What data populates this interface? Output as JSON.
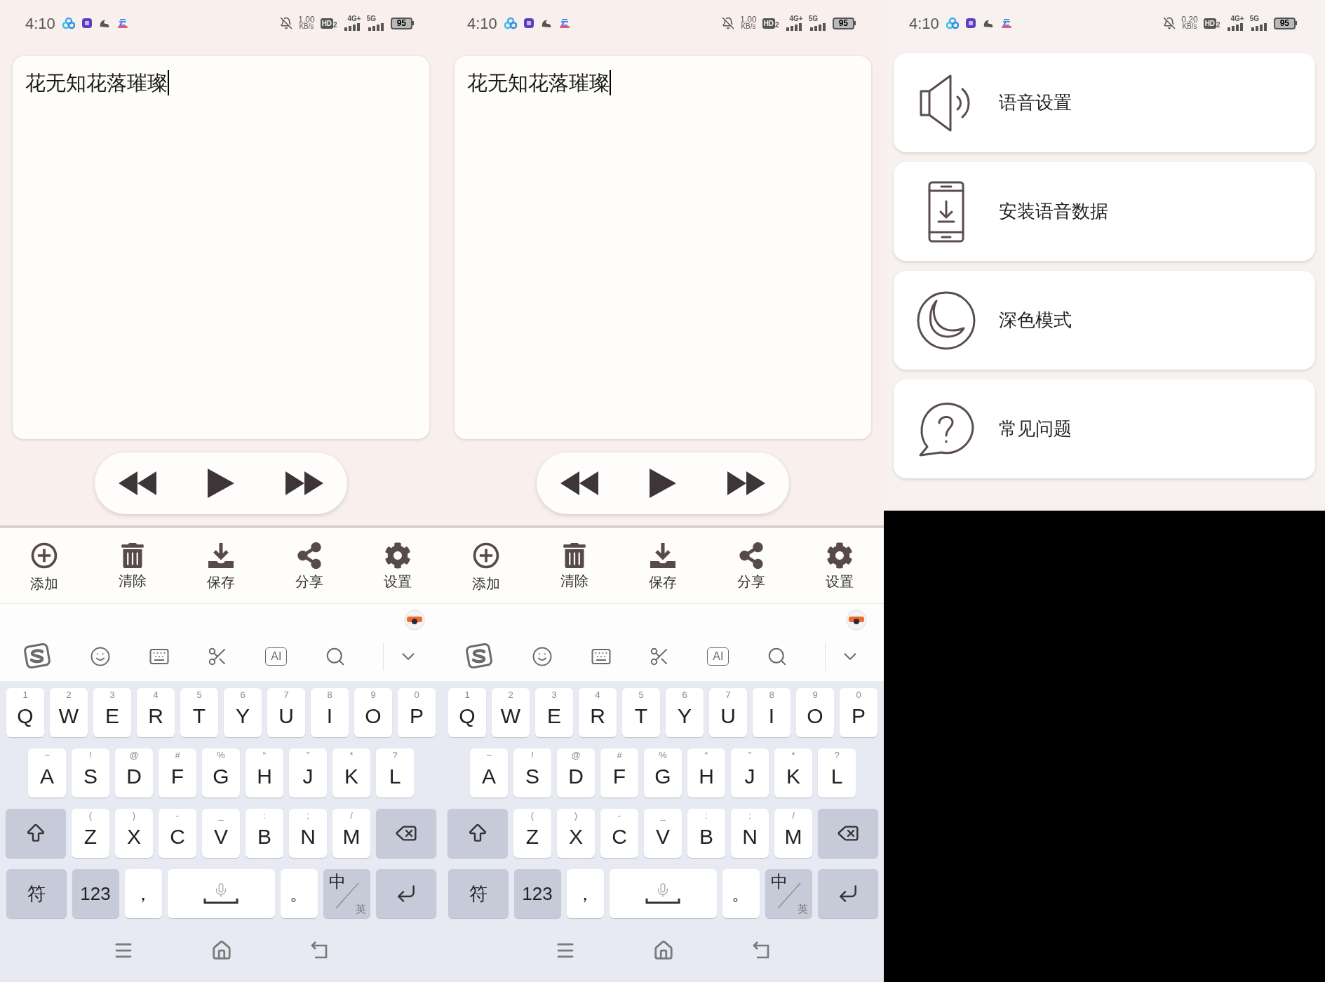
{
  "screens": [
    {
      "kind": "editor",
      "status_bar": {
        "time": "4:10",
        "speed": "1.00",
        "speed_unit": "KB/s",
        "hd": "HD",
        "hd_sub": "2",
        "network_1": "4G+",
        "network_2": "5G",
        "battery": "95"
      },
      "text": "花无知花落璀璨",
      "player": [
        {
          "kind": "rewind"
        },
        {
          "kind": "play"
        },
        {
          "kind": "forward"
        }
      ],
      "toolbar": [
        {
          "kind": "add",
          "label": "添加"
        },
        {
          "kind": "clear",
          "label": "清除"
        },
        {
          "kind": "save",
          "label": "保存"
        },
        {
          "kind": "share",
          "label": "分享"
        },
        {
          "kind": "settings",
          "label": "设置"
        }
      ],
      "keyboard_tools": [
        {
          "kind": "logo"
        },
        {
          "kind": "emoji"
        },
        {
          "kind": "keyboard"
        },
        {
          "kind": "cut"
        },
        {
          "kind": "ai",
          "label": "AI"
        },
        {
          "kind": "search"
        },
        {
          "kind": "collapse"
        }
      ],
      "keyboard_rows": [
        [
          {
            "kind": "letter",
            "label": "Q",
            "hint": "1"
          },
          {
            "kind": "letter",
            "label": "W",
            "hint": "2"
          },
          {
            "kind": "letter",
            "label": "E",
            "hint": "3"
          },
          {
            "kind": "letter",
            "label": "R",
            "hint": "4"
          },
          {
            "kind": "letter",
            "label": "T",
            "hint": "5"
          },
          {
            "kind": "letter",
            "label": "Y",
            "hint": "6"
          },
          {
            "kind": "letter",
            "label": "U",
            "hint": "7"
          },
          {
            "kind": "letter",
            "label": "I",
            "hint": "8"
          },
          {
            "kind": "letter",
            "label": "O",
            "hint": "9"
          },
          {
            "kind": "letter",
            "label": "P",
            "hint": "0"
          }
        ],
        [
          {
            "kind": "letter",
            "label": "A",
            "hint": "~"
          },
          {
            "kind": "letter",
            "label": "S",
            "hint": "!"
          },
          {
            "kind": "letter",
            "label": "D",
            "hint": "@"
          },
          {
            "kind": "letter",
            "label": "F",
            "hint": "#"
          },
          {
            "kind": "letter",
            "label": "G",
            "hint": "%"
          },
          {
            "kind": "letter",
            "label": "H",
            "hint": "“"
          },
          {
            "kind": "letter",
            "label": "J",
            "hint": "”"
          },
          {
            "kind": "letter",
            "label": "K",
            "hint": "*"
          },
          {
            "kind": "letter",
            "label": "L",
            "hint": "?"
          }
        ],
        [
          {
            "kind": "shift"
          },
          {
            "kind": "letter",
            "label": "Z",
            "hint": "("
          },
          {
            "kind": "letter",
            "label": "X",
            "hint": ")"
          },
          {
            "kind": "letter",
            "label": "C",
            "hint": "-"
          },
          {
            "kind": "letter",
            "label": "V",
            "hint": "_"
          },
          {
            "kind": "letter",
            "label": "B",
            "hint": ":"
          },
          {
            "kind": "letter",
            "label": "N",
            "hint": ";"
          },
          {
            "kind": "letter",
            "label": "M",
            "hint": "/"
          },
          {
            "kind": "backspace"
          }
        ],
        [
          {
            "kind": "symbols",
            "label": "符"
          },
          {
            "kind": "numbers",
            "label": "123"
          },
          {
            "kind": "comma",
            "label": "，"
          },
          {
            "kind": "space"
          },
          {
            "kind": "period",
            "label": "。"
          },
          {
            "kind": "lang",
            "label": "中",
            "sub": "英"
          },
          {
            "kind": "enter"
          }
        ]
      ],
      "nav": [
        {
          "kind": "menu"
        },
        {
          "kind": "home"
        },
        {
          "kind": "back"
        }
      ]
    },
    {
      "kind": "editor",
      "status_bar": {
        "time": "4:10",
        "speed": "1.00",
        "speed_unit": "KB/s",
        "hd": "HD",
        "hd_sub": "2",
        "network_1": "4G+",
        "network_2": "5G",
        "battery": "95"
      },
      "text": "花无知花落璀璨",
      "player": [
        {
          "kind": "rewind"
        },
        {
          "kind": "play"
        },
        {
          "kind": "forward"
        }
      ],
      "toolbar": [
        {
          "kind": "add",
          "label": "添加"
        },
        {
          "kind": "clear",
          "label": "清除"
        },
        {
          "kind": "save",
          "label": "保存"
        },
        {
          "kind": "share",
          "label": "分享"
        },
        {
          "kind": "settings",
          "label": "设置"
        }
      ],
      "keyboard_tools": [
        {
          "kind": "logo"
        },
        {
          "kind": "emoji"
        },
        {
          "kind": "keyboard"
        },
        {
          "kind": "cut"
        },
        {
          "kind": "ai",
          "label": "AI"
        },
        {
          "kind": "search"
        },
        {
          "kind": "collapse"
        }
      ],
      "keyboard_rows": [
        [
          {
            "kind": "letter",
            "label": "Q",
            "hint": "1"
          },
          {
            "kind": "letter",
            "label": "W",
            "hint": "2"
          },
          {
            "kind": "letter",
            "label": "E",
            "hint": "3"
          },
          {
            "kind": "letter",
            "label": "R",
            "hint": "4"
          },
          {
            "kind": "letter",
            "label": "T",
            "hint": "5"
          },
          {
            "kind": "letter",
            "label": "Y",
            "hint": "6"
          },
          {
            "kind": "letter",
            "label": "U",
            "hint": "7"
          },
          {
            "kind": "letter",
            "label": "I",
            "hint": "8"
          },
          {
            "kind": "letter",
            "label": "O",
            "hint": "9"
          },
          {
            "kind": "letter",
            "label": "P",
            "hint": "0"
          }
        ],
        [
          {
            "kind": "letter",
            "label": "A",
            "hint": "~"
          },
          {
            "kind": "letter",
            "label": "S",
            "hint": "!"
          },
          {
            "kind": "letter",
            "label": "D",
            "hint": "@"
          },
          {
            "kind": "letter",
            "label": "F",
            "hint": "#"
          },
          {
            "kind": "letter",
            "label": "G",
            "hint": "%"
          },
          {
            "kind": "letter",
            "label": "H",
            "hint": "“"
          },
          {
            "kind": "letter",
            "label": "J",
            "hint": "”"
          },
          {
            "kind": "letter",
            "label": "K",
            "hint": "*"
          },
          {
            "kind": "letter",
            "label": "L",
            "hint": "?"
          }
        ],
        [
          {
            "kind": "shift"
          },
          {
            "kind": "letter",
            "label": "Z",
            "hint": "("
          },
          {
            "kind": "letter",
            "label": "X",
            "hint": ")"
          },
          {
            "kind": "letter",
            "label": "C",
            "hint": "-"
          },
          {
            "kind": "letter",
            "label": "V",
            "hint": "_"
          },
          {
            "kind": "letter",
            "label": "B",
            "hint": ":"
          },
          {
            "kind": "letter",
            "label": "N",
            "hint": ";"
          },
          {
            "kind": "letter",
            "label": "M",
            "hint": "/"
          },
          {
            "kind": "backspace"
          }
        ],
        [
          {
            "kind": "symbols",
            "label": "符"
          },
          {
            "kind": "numbers",
            "label": "123"
          },
          {
            "kind": "comma",
            "label": "，"
          },
          {
            "kind": "space"
          },
          {
            "kind": "period",
            "label": "。"
          },
          {
            "kind": "lang",
            "label": "中",
            "sub": "英"
          },
          {
            "kind": "enter"
          }
        ]
      ],
      "nav": [
        {
          "kind": "menu"
        },
        {
          "kind": "home"
        },
        {
          "kind": "back"
        }
      ]
    },
    {
      "kind": "settings",
      "status_bar": {
        "time": "4:10",
        "speed": "0.20",
        "speed_unit": "KB/s",
        "hd": "HD",
        "hd_sub": "2",
        "network_1": "4G+",
        "network_2": "5G",
        "battery": "95"
      },
      "items": [
        {
          "kind": "speaker",
          "label": "语音设置"
        },
        {
          "kind": "phone-download",
          "label": "安装语音数据"
        },
        {
          "kind": "moon",
          "label": "深色模式"
        },
        {
          "kind": "question",
          "label": "常见问题"
        }
      ]
    }
  ]
}
